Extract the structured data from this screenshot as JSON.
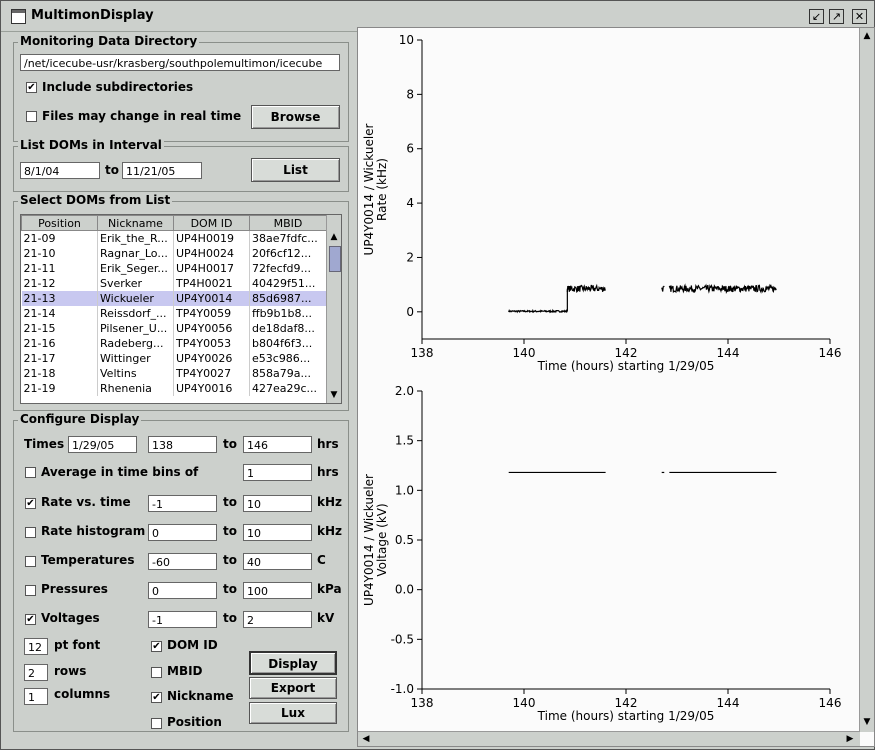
{
  "window": {
    "title": "MultimonDisplay"
  },
  "monitoring": {
    "group_title": "Monitoring Data Directory",
    "directory": "/net/icecube-usr/krasberg/southpolemultimon/icecube",
    "include_subdirs_label": "Include subdirectories",
    "include_subdirs_checked": true,
    "files_change_label": "Files may change in real time",
    "files_change_checked": false,
    "browse_label": "Browse"
  },
  "list_interval": {
    "group_title": "List DOMs in Interval",
    "from": "8/1/04",
    "to_label": "to",
    "to": "11/21/05",
    "list_label": "List"
  },
  "dom_list": {
    "group_title": "Select DOMs from List",
    "columns": [
      "Position",
      "Nickname",
      "DOM ID",
      "MBID"
    ],
    "rows": [
      [
        "21-09",
        "Erik_the_R...",
        "UP4H0019",
        "38ae7fdfc..."
      ],
      [
        "21-10",
        "Ragnar_Lo...",
        "UP4H0024",
        "20f6cf12..."
      ],
      [
        "21-11",
        "Erik_Seger...",
        "UP4H0017",
        "72fecfd9..."
      ],
      [
        "21-12",
        "Sverker",
        "TP4H0021",
        "40429f51..."
      ],
      [
        "21-13",
        "Wickueler",
        "UP4Y0014",
        "85d6987..."
      ],
      [
        "21-14",
        "Reissdorf_...",
        "TP4Y0059",
        "ffb9b1b8..."
      ],
      [
        "21-15",
        "Pilsener_U...",
        "UP4Y0056",
        "de18daf8..."
      ],
      [
        "21-16",
        "Radeberg...",
        "TP4Y0053",
        "b804f6f3..."
      ],
      [
        "21-17",
        "Wittinger",
        "UP4Y0026",
        "e53c986..."
      ],
      [
        "21-18",
        "Veltins",
        "TP4Y0027",
        "858a79a..."
      ],
      [
        "21-19",
        "Rhenenia",
        "UP4Y0016",
        "427ea29c..."
      ]
    ],
    "selected_index": 4
  },
  "configure": {
    "group_title": "Configure Display",
    "times_label": "Times",
    "times_date": "1/29/05",
    "times_from": "138",
    "times_to": "146",
    "hrs": "hrs",
    "to": "to",
    "avg_label": "Average in time bins of",
    "avg_checked": false,
    "avg_value": "1",
    "rows": [
      {
        "label": "Rate vs. time",
        "checked": true,
        "min": "-1",
        "max": "10",
        "unit": "kHz"
      },
      {
        "label": "Rate histogram",
        "checked": false,
        "min": "0",
        "max": "10",
        "unit": "kHz"
      },
      {
        "label": "Temperatures",
        "checked": false,
        "min": "-60",
        "max": "40",
        "unit": "C"
      },
      {
        "label": "Pressures",
        "checked": false,
        "min": "0",
        "max": "100",
        "unit": "kPa"
      },
      {
        "label": "Voltages",
        "checked": true,
        "min": "-1",
        "max": "2",
        "unit": "kV"
      }
    ],
    "font_value": "12",
    "font_label": "pt font",
    "rows_value": "2",
    "rows_label": "rows",
    "cols_value": "1",
    "cols_label": "columns",
    "opt_domid": {
      "label": "DOM ID",
      "checked": true
    },
    "opt_mbid": {
      "label": "MBID",
      "checked": false
    },
    "opt_nickname": {
      "label": "Nickname",
      "checked": true
    },
    "opt_position": {
      "label": "Position",
      "checked": false
    },
    "display_label": "Display",
    "export_label": "Export",
    "lux_label": "Lux"
  },
  "check_mark": "✔",
  "chart_data": [
    {
      "type": "line",
      "ylabel_line1": "UP4Y0014 / Wickueler",
      "ylabel_line2": "Rate (kHz)",
      "xlabel": "Time (hours) starting 1/29/05",
      "xlim": [
        138,
        146
      ],
      "ylim": [
        -1,
        10
      ],
      "xticks": [
        138,
        140,
        142,
        144,
        146
      ],
      "yticks": [
        0,
        2,
        4,
        6,
        8,
        10
      ],
      "segments": [
        {
          "x": [
            139.7,
            140.85
          ],
          "y": [
            0.02,
            0.02
          ],
          "noise": 0.03
        },
        {
          "x": [
            140.85,
            141.6
          ],
          "y": [
            0.85,
            0.85
          ],
          "noise": 0.12
        },
        {
          "x": [
            142.7,
            142.75
          ],
          "y": [
            0.85,
            0.85
          ],
          "noise": 0.12
        },
        {
          "x": [
            142.85,
            144.95
          ],
          "y": [
            0.85,
            0.85
          ],
          "noise": 0.12
        }
      ]
    },
    {
      "type": "line",
      "ylabel_line1": "UP4Y0014 / Wickueler",
      "ylabel_line2": "Voltage (kV)",
      "xlabel": "Time (hours) starting 1/29/05",
      "xlim": [
        138,
        146
      ],
      "ylim": [
        -1,
        2
      ],
      "xticks": [
        138,
        140,
        142,
        144,
        146
      ],
      "yticks": [
        -1.0,
        -0.5,
        0.0,
        0.5,
        1.0,
        1.5,
        2.0
      ],
      "segments": [
        {
          "x": [
            139.7,
            141.6
          ],
          "y": [
            1.18,
            1.18
          ],
          "noise": 0
        },
        {
          "x": [
            142.7,
            142.75
          ],
          "y": [
            1.18,
            1.18
          ],
          "noise": 0
        },
        {
          "x": [
            142.85,
            144.95
          ],
          "y": [
            1.18,
            1.18
          ],
          "noise": 0
        }
      ]
    }
  ]
}
